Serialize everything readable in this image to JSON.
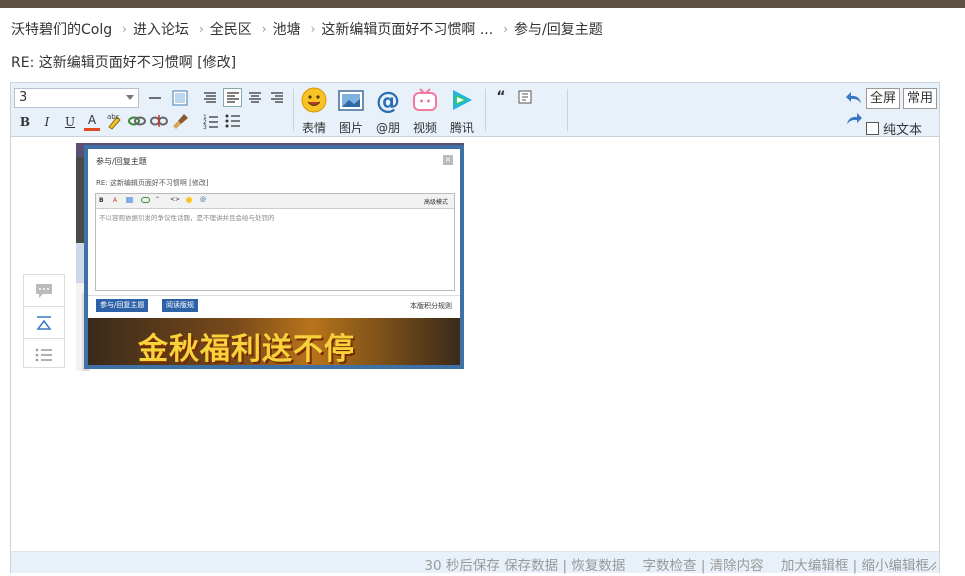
{
  "breadcrumb": {
    "items": [
      "沃特碧们的Colg",
      "进入论坛",
      "全民区",
      "池塘",
      "这新编辑页面好不习惯啊 ...",
      "参与/回复主题"
    ],
    "separator": "›"
  },
  "subject": "RE: 这新编辑页面好不习惯啊 [修改]",
  "toolbar": {
    "font_size": "3",
    "bold": "B",
    "italic": "I",
    "underline": "U",
    "color": "A",
    "quote": "“",
    "smiley": "表情",
    "image": "图片",
    "mention": "@朋",
    "video": "视频",
    "tencent": "腾讯",
    "fullscreen": "全屏",
    "common": "常用",
    "plain_text": "纯文本"
  },
  "dialog": {
    "title": "参与/回复主题",
    "subject": "RE: 这新编辑页面好不习惯啊 [修改]",
    "advanced": "高级模式",
    "placeholder": "不以容观依据引发的争议性话题，是不理讲并且会给与处罚的",
    "reply_button": "参与/回复主题",
    "read_button": "阅读版规",
    "rules_link": "本版积分规则",
    "banner": "金秋福利送不停"
  },
  "status": {
    "autosave": "30 秒后保存",
    "save": "保存数据",
    "restore": "恢复数据",
    "count": "字数检查",
    "clear": "清除内容",
    "enlarge": "加大编辑框",
    "shrink": "缩小编辑框",
    "divider": "|"
  },
  "colors": {
    "dialog_border": "#3f71a6",
    "toolbar_bg": "#e8f1fa",
    "topbar": "#5e5243"
  }
}
